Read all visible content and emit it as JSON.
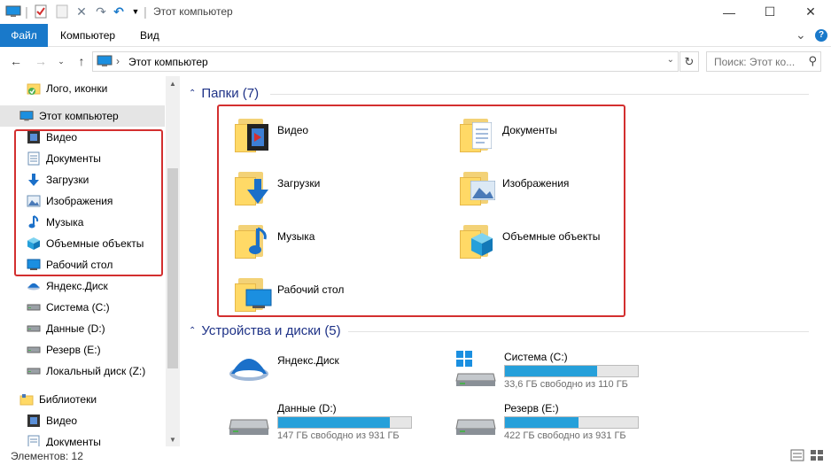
{
  "window": {
    "title": "Этот компьютер",
    "controls": {
      "minimize": "—",
      "maximize": "☐",
      "close": "✕"
    }
  },
  "ribbon": {
    "tabs": [
      {
        "label": "Файл"
      },
      {
        "label": "Компьютер"
      },
      {
        "label": "Вид"
      }
    ],
    "expand": "⌄",
    "help": "?"
  },
  "address": {
    "path_separator": "›",
    "path": "Этот компьютер",
    "search_placeholder": "Поиск: Этот ко..."
  },
  "nav": {
    "items": [
      {
        "label": "Лого, иконки",
        "icon": "folder-check-icon"
      },
      {
        "label": "Этот компьютер",
        "icon": "computer-icon"
      },
      {
        "label": "Видео",
        "icon": "video-icon"
      },
      {
        "label": "Документы",
        "icon": "documents-icon"
      },
      {
        "label": "Загрузки",
        "icon": "downloads-icon"
      },
      {
        "label": "Изображения",
        "icon": "pictures-icon"
      },
      {
        "label": "Музыка",
        "icon": "music-icon"
      },
      {
        "label": "Объемные объекты",
        "icon": "3d-objects-icon"
      },
      {
        "label": "Рабочий стол",
        "icon": "desktop-icon"
      },
      {
        "label": "Яндекс.Диск",
        "icon": "yandex-disk-icon"
      },
      {
        "label": "Система (C:)",
        "icon": "drive-icon"
      },
      {
        "label": "Данные (D:)",
        "icon": "drive-icon"
      },
      {
        "label": "Резерв (E:)",
        "icon": "drive-icon"
      },
      {
        "label": "Локальный диск (Z:)",
        "icon": "drive-icon"
      },
      {
        "label": "Библиотеки",
        "icon": "libraries-icon"
      },
      {
        "label": "Видео",
        "icon": "video-icon"
      },
      {
        "label": "Документы",
        "icon": "documents-icon"
      }
    ]
  },
  "main": {
    "folders_header": "Папки (7)",
    "folders": [
      {
        "label": "Видео",
        "icon": "video-folder-icon"
      },
      {
        "label": "Документы",
        "icon": "documents-folder-icon"
      },
      {
        "label": "Загрузки",
        "icon": "downloads-folder-icon"
      },
      {
        "label": "Изображения",
        "icon": "pictures-folder-icon"
      },
      {
        "label": "Музыка",
        "icon": "music-folder-icon"
      },
      {
        "label": "Объемные объекты",
        "icon": "3d-objects-folder-icon"
      },
      {
        "label": "Рабочий стол",
        "icon": "desktop-folder-icon"
      }
    ],
    "drives_header": "Устройства и диски (5)",
    "drives": [
      {
        "name": "Яндекс.Диск",
        "icon": "yandex-disk-icon"
      },
      {
        "name": "Система (C:)",
        "free": "33,6 ГБ свободно из 110 ГБ",
        "used_fraction": 0.69,
        "icon": "windows-drive-icon"
      },
      {
        "name": "Данные (D:)",
        "free": "147 ГБ свободно из 931 ГБ",
        "used_fraction": 0.84,
        "icon": "drive-icon"
      },
      {
        "name": "Резерв (E:)",
        "free": "422 ГБ свободно из 931 ГБ",
        "used_fraction": 0.55,
        "icon": "drive-icon"
      }
    ]
  },
  "status": {
    "items_count": "Элементов: 12"
  },
  "colors": {
    "accent": "#1979ca",
    "highlight_border": "#d32f2f",
    "drive_bar": "#26a0da",
    "group_header": "#1e3287"
  }
}
